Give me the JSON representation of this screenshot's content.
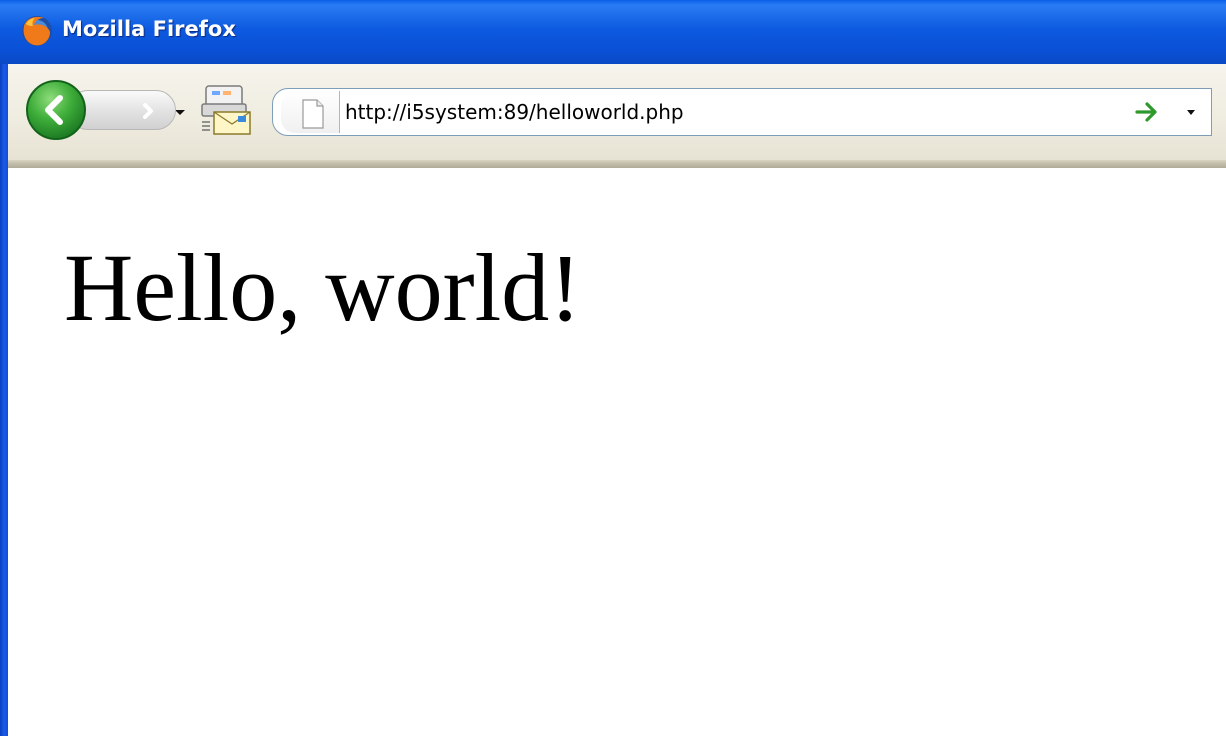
{
  "window": {
    "title": "Mozilla Firefox"
  },
  "toolbar": {
    "back_icon": "back-arrow-icon",
    "forward_icon": "forward-arrow-icon",
    "history_dropdown_icon": "chevron-down-icon",
    "mail_icon": "mail-icon",
    "url": "http://i5system:89/helloworld.php",
    "go_icon": "go-arrow-icon",
    "url_dropdown_icon": "chevron-down-icon",
    "page_icon": "page-icon"
  },
  "page": {
    "heading": "Hello, world!"
  },
  "colors": {
    "titlebar": "#0a50d6",
    "back_button": "#3fae3a",
    "go_arrow": "#2e9a2e"
  }
}
